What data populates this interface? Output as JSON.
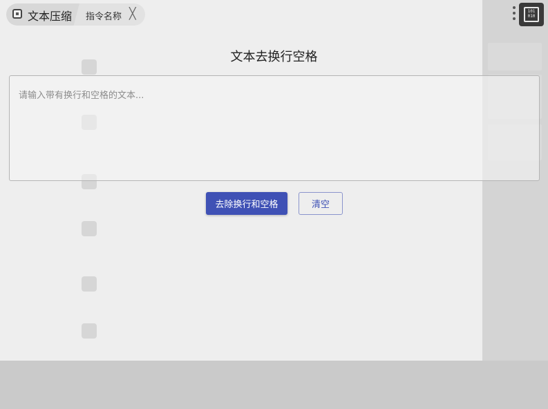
{
  "header": {
    "active_tab_label": "文本压缩",
    "command_tab_label": "指令名称",
    "close_glyph": "╳",
    "app_logo_text": "101\n010"
  },
  "main": {
    "title": "文本去换行空格",
    "input": {
      "value": "",
      "placeholder": "请输入带有换行和空格的文本..."
    },
    "buttons": {
      "remove_label": "去除换行和空格",
      "clear_label": "清空"
    }
  },
  "colors": {
    "primary": "#3f51b5",
    "overlay": "#eeeeee"
  }
}
